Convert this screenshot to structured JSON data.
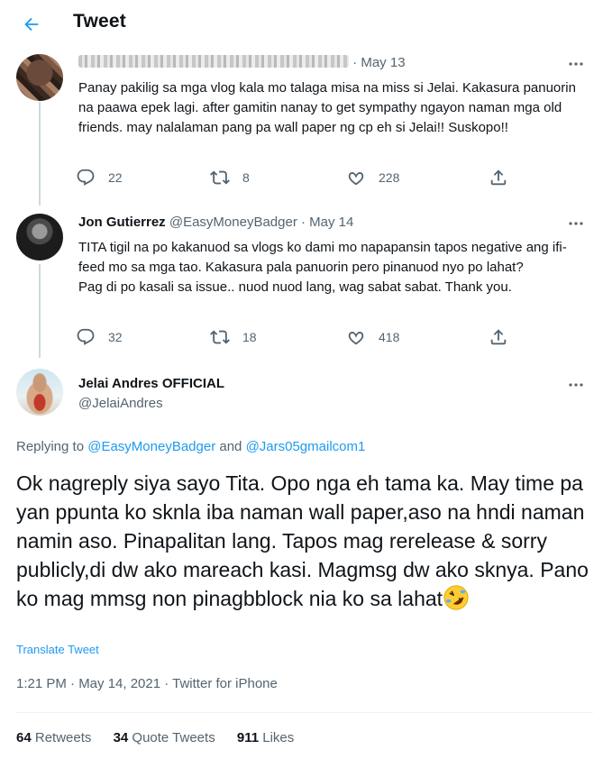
{
  "header": {
    "title": "Tweet",
    "back_icon": "arrow-left-icon",
    "accent": "#1d9bf0"
  },
  "tweets": [
    {
      "name": "",
      "handle": "",
      "date": "May 13",
      "separator": " · ",
      "text": "Panay pakilig sa mga vlog kala mo talaga misa na miss si Jelai. Kakasura panuorin na paawa epek lagi. after gamitin nanay to get sympathy ngayon naman mga old friends. may nalalaman pang pa wall paper ng cp eh si Jelai!! Suskopo!!",
      "replies": "22",
      "retweets": "8",
      "likes": "228"
    },
    {
      "name": "Jon Gutierrez",
      "handle": "@EasyMoneyBadger",
      "date": "May 14",
      "separator": " · ",
      "text_lines": [
        "TITA tigil na po kakanuod sa vlogs ko dami mo napapansin tapos negative ang ifi-feed mo sa mga tao. Kakasura pala panuorin pero pinanuod nyo po lahat?",
        "Pag di po kasali sa issue.. nuod nuod lang, wag sabat sabat. Thank you."
      ],
      "replies": "32",
      "retweets": "18",
      "likes": "418"
    }
  ],
  "main_tweet": {
    "name": "Jelai Andres OFFICIAL",
    "handle": "@JelaiAndres",
    "replying_prefix": "Replying to ",
    "replying_to_1": "@EasyMoneyBadger",
    "replying_and": " and ",
    "replying_to_2": "@Jars05gmailcom1",
    "text": "Ok nagreply siya sayo Tita. Opo nga eh tama ka. May time pa yan ppunta ko sknla iba naman wall paper,aso na hndi naman namin aso. Pinapalitan lang. Tapos mag rerelease & sorry publicly,di dw ako mareach kasi. Magmsg dw ako sknya. Pano ko mag mmsg non pinagbblock nia ko sa lahat",
    "emoji": "rolling-on-floor-laughing-emoji",
    "translate_label": "Translate Tweet",
    "timestamp": "1:21 PM · May 14, 2021 · Twitter for iPhone",
    "retweets_count": "64",
    "retweets_label": " Retweets",
    "quote_count": "34",
    "quote_label": " Quote Tweets",
    "likes_count": "911",
    "likes_label": " Likes"
  },
  "icons": {
    "reply": "reply-icon",
    "retweet": "retweet-icon",
    "like": "heart-icon",
    "share": "share-icon",
    "more": "more-icon"
  }
}
